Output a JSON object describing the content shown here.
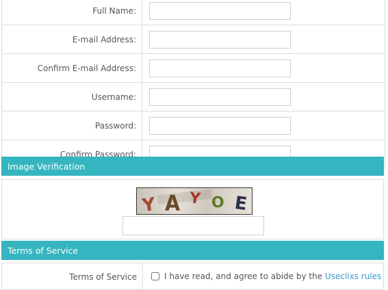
{
  "form": {
    "fields": [
      {
        "label": "Full Name:",
        "value": "",
        "name": "full-name"
      },
      {
        "label": "E-mail Address:",
        "value": "",
        "name": "email"
      },
      {
        "label": "Confirm E-mail Address:",
        "value": "",
        "name": "confirm-email"
      },
      {
        "label": "Username:",
        "value": "",
        "name": "username"
      },
      {
        "label": "Password:",
        "value": "",
        "name": "password"
      },
      {
        "label": "Confirm Password:",
        "value": "",
        "name": "confirm-password"
      }
    ]
  },
  "image_verification": {
    "header": "Image Verification",
    "captcha_chars": [
      "Y",
      "A",
      "Y",
      "O",
      "E"
    ],
    "input_value": ""
  },
  "terms": {
    "header": "Terms of Service",
    "row_label": "Terms of Service",
    "checkbox_checked": false,
    "agree_text": "I have read, and agree to abide by the",
    "link_text": "Useclixs rules"
  },
  "colors": {
    "section_header_bg": "#35b5bf",
    "link": "#3a96c8"
  }
}
